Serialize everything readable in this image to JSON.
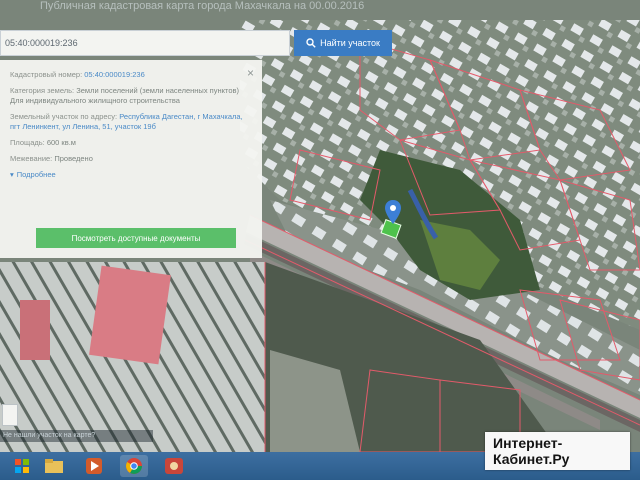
{
  "page": {
    "title": "Публичная кадастровая карта города Махачкала на 00.00.2016"
  },
  "search": {
    "value": "05:40:000019:236",
    "button_label": "Найти участок"
  },
  "card": {
    "cad_label": "Кадастровый номер:",
    "cad_value": "05:40:000019:236",
    "category_label": "Категория земель:",
    "category_value": "Земли поселений (земли населенных пунктов)",
    "use_value": "Для индивидуального жилищного строительства",
    "address_label": "Земельный участок по адресу:",
    "address_value": "Республика Дагестан, г Махачкала, пгт Ленинкент, ул Ленина, 51, участок 19б",
    "area_label": "Площадь:",
    "area_value": "600 кв.м",
    "bounds_label": "Межевание:",
    "bounds_value": "Проведено",
    "more_label": "Подробнее",
    "docs_button": "Посмотреть доступные документы"
  },
  "map": {
    "note": "Не нашли участок на карте?"
  },
  "watermark": {
    "line1": "Интернет-",
    "line2": "Кабинет.Ру"
  },
  "colors": {
    "search_button": "#3a7cc4",
    "docs_button": "#5bbf6a",
    "taskbar": "#2b5c8b",
    "parcel_border": "#e35a6a",
    "marker": "#3d7fd6"
  }
}
